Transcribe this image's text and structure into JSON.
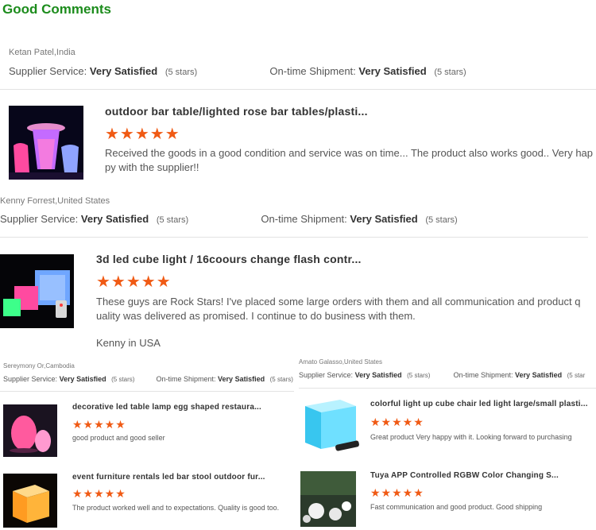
{
  "section_title": "Good Comments",
  "reviews": [
    {
      "reviewer": "Ketan Patel,India",
      "supplier_label": "Supplier Service:",
      "supplier_value": "Very Satisfied",
      "supplier_stars": "(5 stars)",
      "shipment_label": "On-time Shipment:",
      "shipment_value": "Very Satisfied",
      "shipment_stars": "(5 stars)",
      "product_title": "outdoor bar table/lighted rose bar tables/plasti...",
      "stars": "★★★★★",
      "comment": "Received the goods in a good condition and service was on time... The product also works good.. Very hap py with the supplier!!"
    },
    {
      "reviewer": "Kenny Forrest,United States",
      "supplier_label": "Supplier Service:",
      "supplier_value": "Very Satisfied",
      "supplier_stars": "(5 stars)",
      "shipment_label": "On-time Shipment:",
      "shipment_value": "Very Satisfied",
      "shipment_stars": "(5 stars)",
      "product_title": "3d led cube light / 16coours change flash contr...",
      "stars": "★★★★★",
      "comment": "These guys are Rock Stars!  I've placed some large orders with them and all communication and product q uality was delivered as promised.  I continue to do business with them.",
      "signature": "Kenny in USA"
    }
  ],
  "small_reviews": [
    {
      "reviewer": "Sereymony Or,Cambodia",
      "supplier_label": "Supplier Service:",
      "supplier_value": "Very Satisfied",
      "supplier_stars": "(5 stars)",
      "shipment_label": "On-time Shipment:",
      "shipment_value": "Very Satisfied",
      "shipment_stars": "(5 stars)",
      "items": [
        {
          "title": "decorative led table lamp egg shaped restaura...",
          "stars": "★★★★★",
          "comment": "good product and good seller"
        },
        {
          "title": "event furniture rentals led bar stool outdoor fur...",
          "stars": "★★★★★",
          "comment": "The product worked well and to expectations. Quality is good too."
        }
      ]
    },
    {
      "reviewer": "Amato Galasso,United States",
      "supplier_label": "Supplier Service:",
      "supplier_value": "Very Satisfied",
      "supplier_stars": "(5 stars)",
      "shipment_label": "On-time Shipment:",
      "shipment_value": "Very Satisfied",
      "shipment_stars": "(5 star",
      "items": [
        {
          "title": "colorful light up cube chair led light large/small plasti...",
          "stars": "★★★★★",
          "comment": "Great product   Very happy with it.  Looking forward to purchasing"
        },
        {
          "title": "Tuya APP Controlled RGBW Color Changing S...",
          "stars": "★★★★★",
          "comment": "Fast communication and good product. Good shipping"
        }
      ]
    }
  ],
  "colors": {
    "title_green": "#1c8c1c",
    "star_orange": "#f05a14"
  }
}
